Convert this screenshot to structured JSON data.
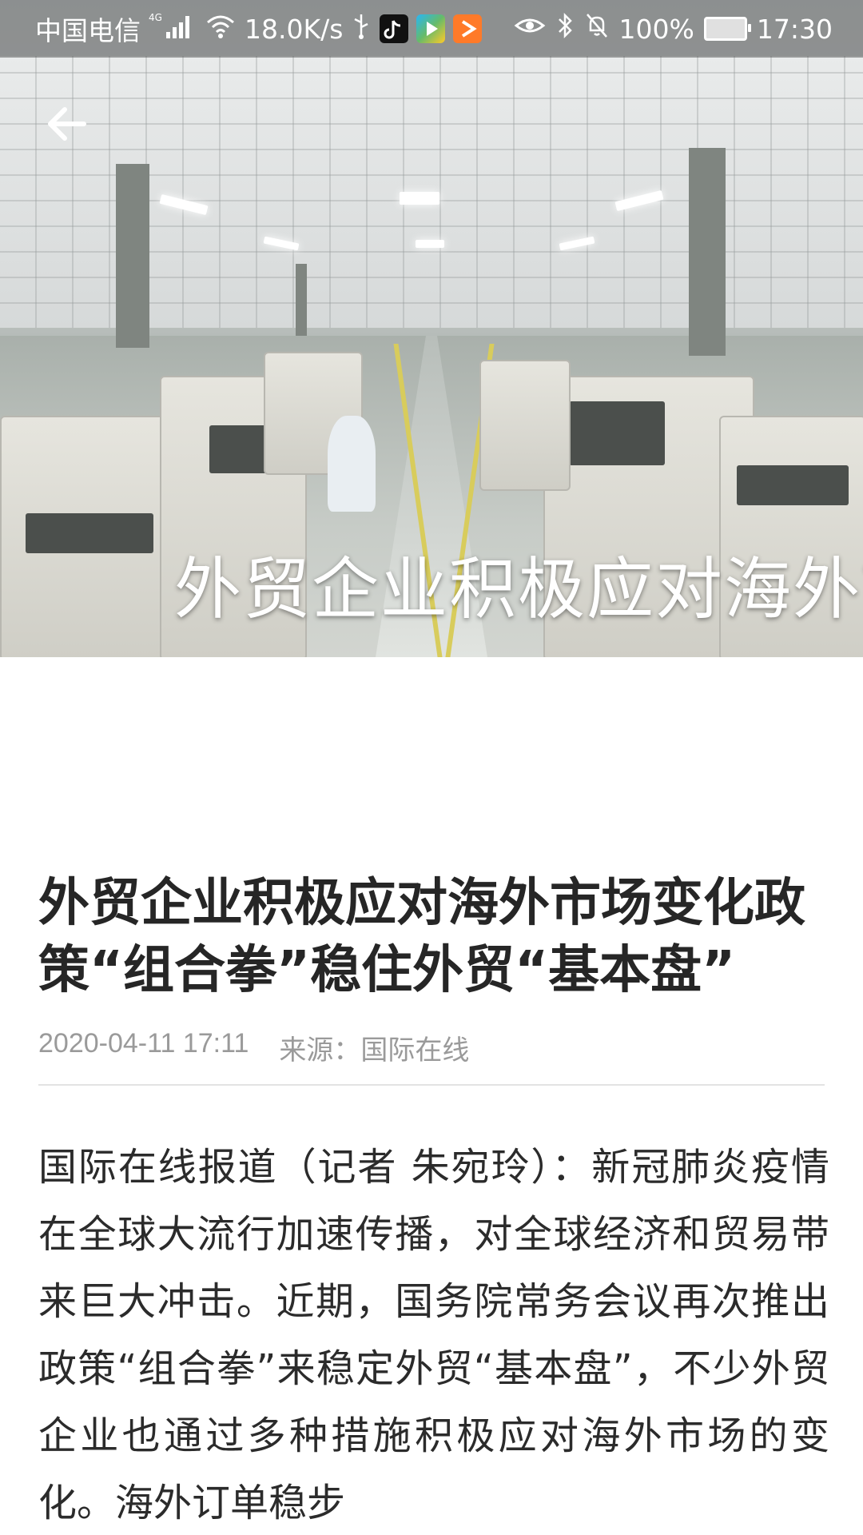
{
  "status_bar": {
    "carrier": "中国电信",
    "network": "4G",
    "speed": "18.0K/s",
    "battery": "100%",
    "time": "17:30",
    "icons": [
      "signal-icon",
      "wifi-icon",
      "usb-icon",
      "tiktok-icon",
      "video-app-icon",
      "player-app-icon",
      "eye-icon",
      "bluetooth-icon",
      "mute-icon",
      "battery-icon"
    ]
  },
  "hero": {
    "title": "外贸企业积极应对海外市场变化"
  },
  "article": {
    "title": "外贸企业积极应对海外市场变化政策“组合拳”稳住外贸“基本盘”",
    "date": "2020-04-11 17:11",
    "source": "来源：国际在线",
    "body": "国际在线报道（记者 朱宛玲）：新冠肺炎疫情在全球大流行加速传播，对全球经济和贸易带来巨大冲击。近期，国务院常务会议再次推出政策“组合拳”来稳定外贸“基本盘”，不少外贸企业也通过多种措施积极应对海外市场的变化。海外订单稳步"
  }
}
